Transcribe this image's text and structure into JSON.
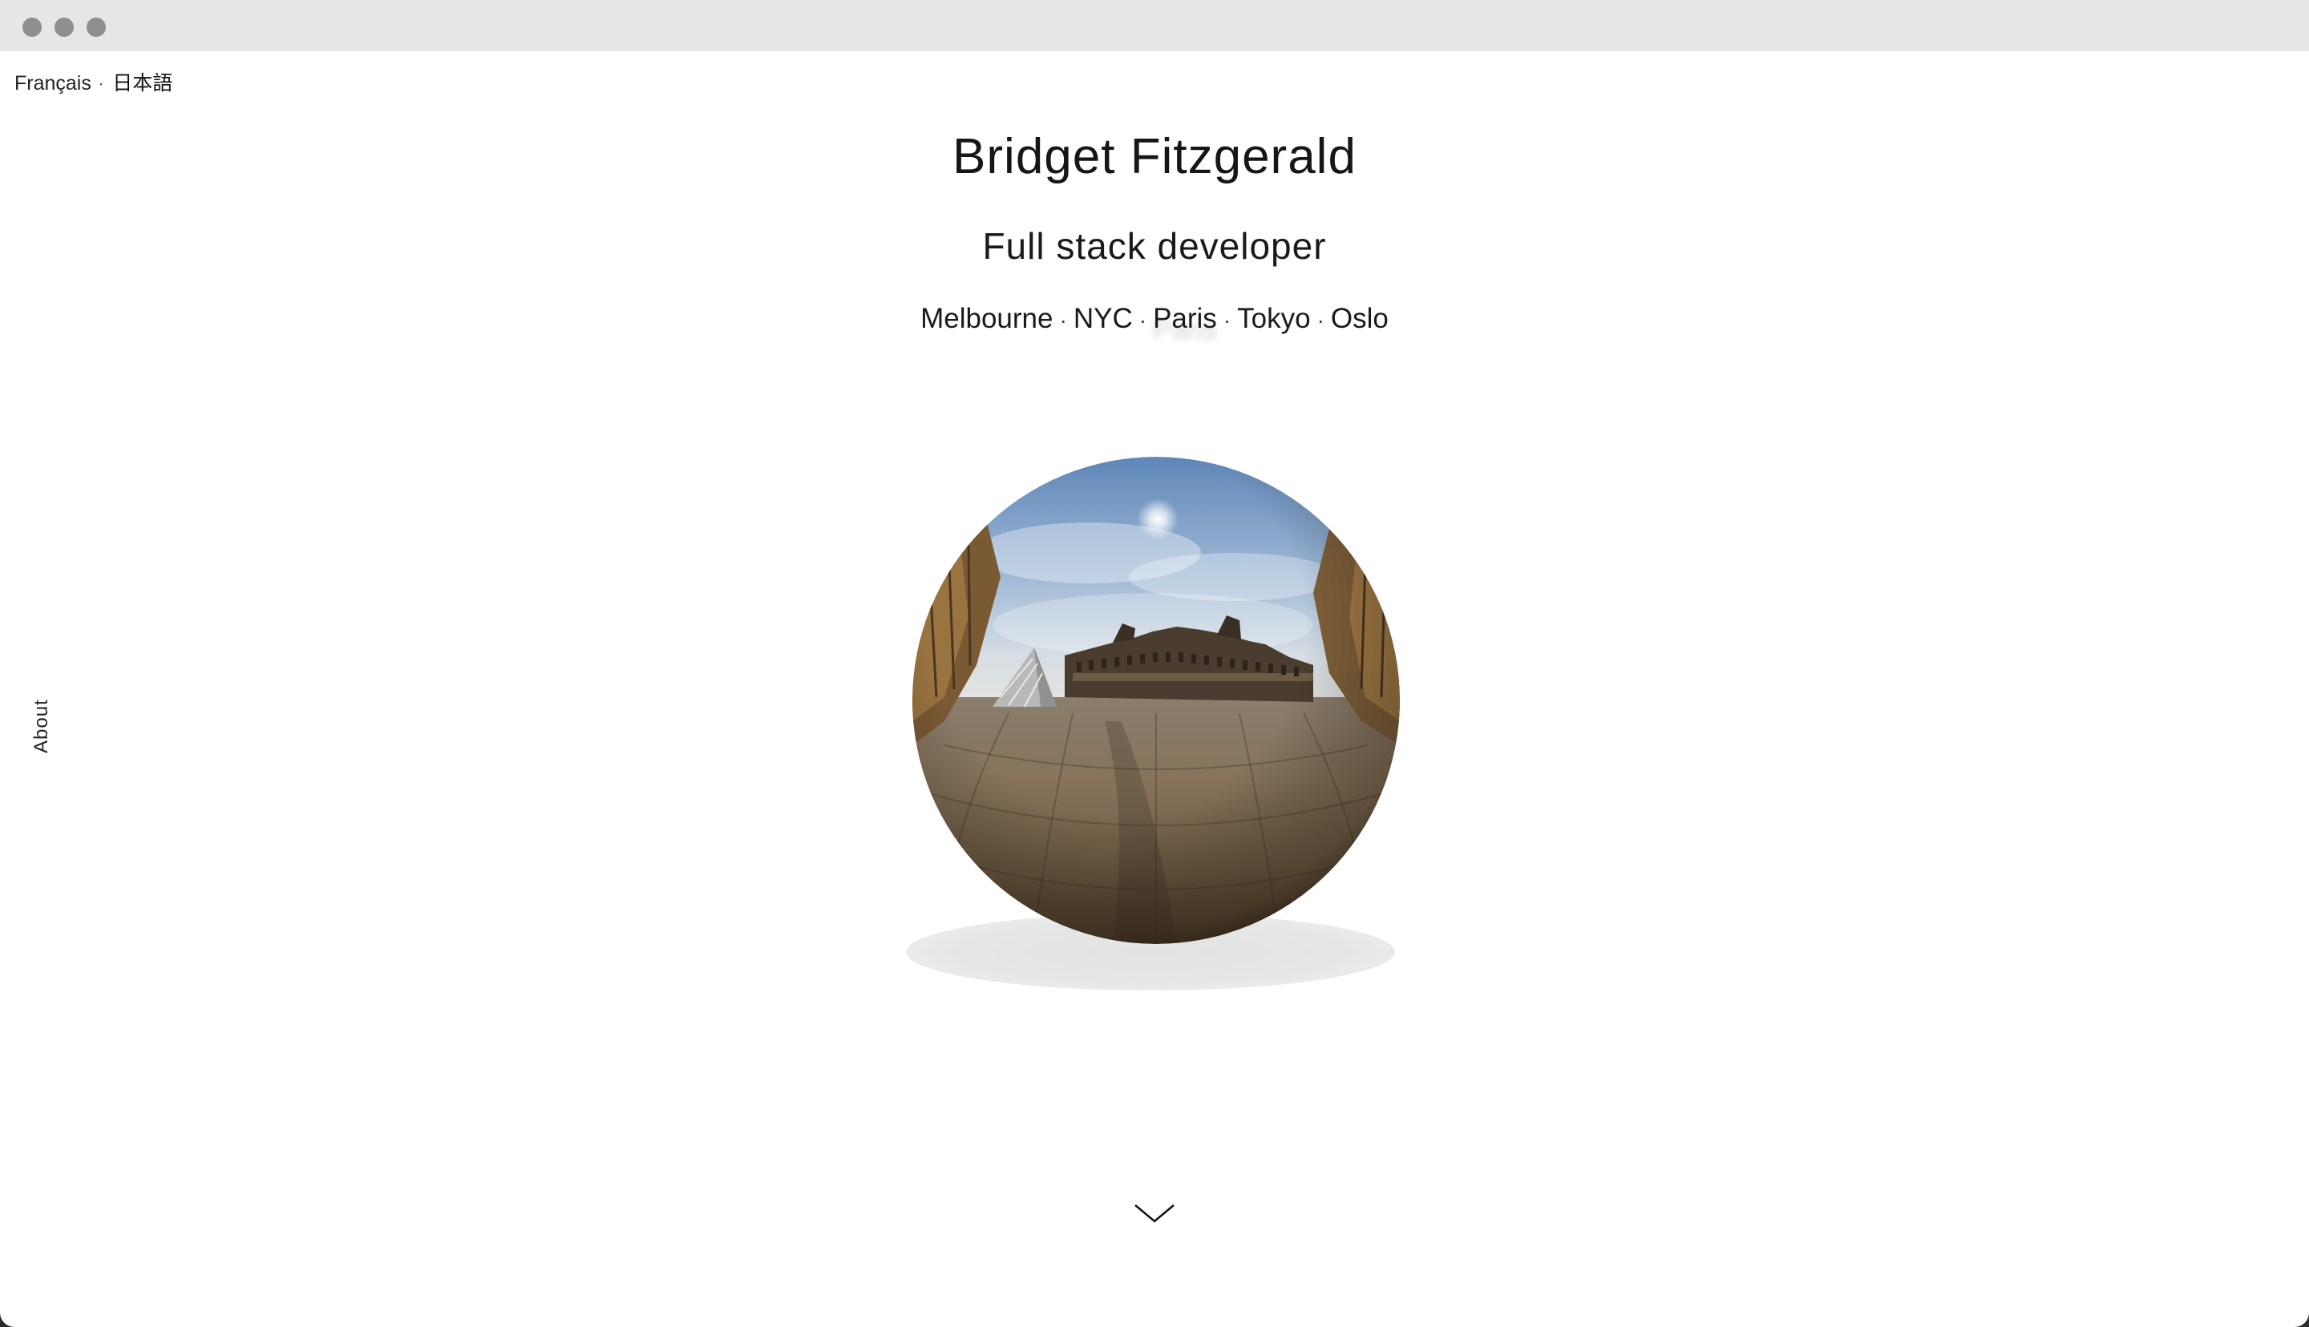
{
  "window": {
    "controls": [
      "close",
      "minimize",
      "maximize"
    ]
  },
  "language_switcher": {
    "items": [
      {
        "label": "Français",
        "active": false
      },
      {
        "label": "日本語",
        "active": true
      }
    ],
    "separator": "·"
  },
  "hero": {
    "name": "Bridget Fitzgerald",
    "role": "Full stack developer",
    "cities": [
      "Melbourne",
      "NYC",
      "Paris",
      "Tokyo",
      "Oslo"
    ],
    "city_separator": "·",
    "highlighted_city": "Paris"
  },
  "side_nav": {
    "about_label": "About"
  },
  "scroll_indicator": {
    "icon": "chevron-down-icon"
  },
  "colors": {
    "background": "#ffffff",
    "titlebar": "#e6e6e6",
    "text": "#161616"
  }
}
